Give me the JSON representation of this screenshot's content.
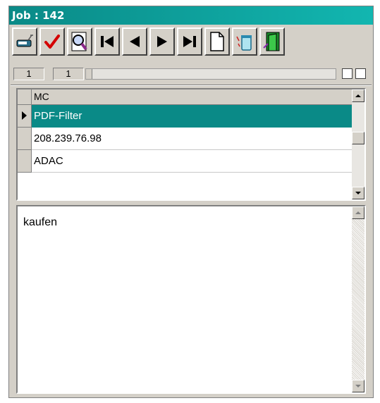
{
  "window": {
    "title": "Job : 142"
  },
  "toolbar": {
    "buttons": [
      {
        "name": "post-button",
        "icon": "post-record-icon"
      },
      {
        "name": "confirm-button",
        "icon": "checkmark-icon"
      },
      {
        "name": "search-button",
        "icon": "magnifier-icon"
      },
      {
        "name": "first-record-button",
        "icon": "first-icon"
      },
      {
        "name": "prior-record-button",
        "icon": "prior-icon"
      },
      {
        "name": "next-record-button",
        "icon": "next-icon"
      },
      {
        "name": "last-record-button",
        "icon": "last-icon"
      },
      {
        "name": "new-record-button",
        "icon": "new-document-icon"
      },
      {
        "name": "delete-button",
        "icon": "trash-icon"
      },
      {
        "name": "exit-button",
        "icon": "exit-door-icon"
      }
    ]
  },
  "status": {
    "record_index": "1",
    "record_count": "1"
  },
  "grid": {
    "header": "MC",
    "rows": [
      {
        "value": "PDF-Filter",
        "selected": true
      },
      {
        "value": "208.239.76.98",
        "selected": false
      },
      {
        "value": "ADAC",
        "selected": false
      }
    ]
  },
  "memo": {
    "text": "kaufen"
  },
  "colors": {
    "accent": "#0a8a87",
    "face": "#d4d0c8",
    "selected_text": "#ffffff"
  }
}
